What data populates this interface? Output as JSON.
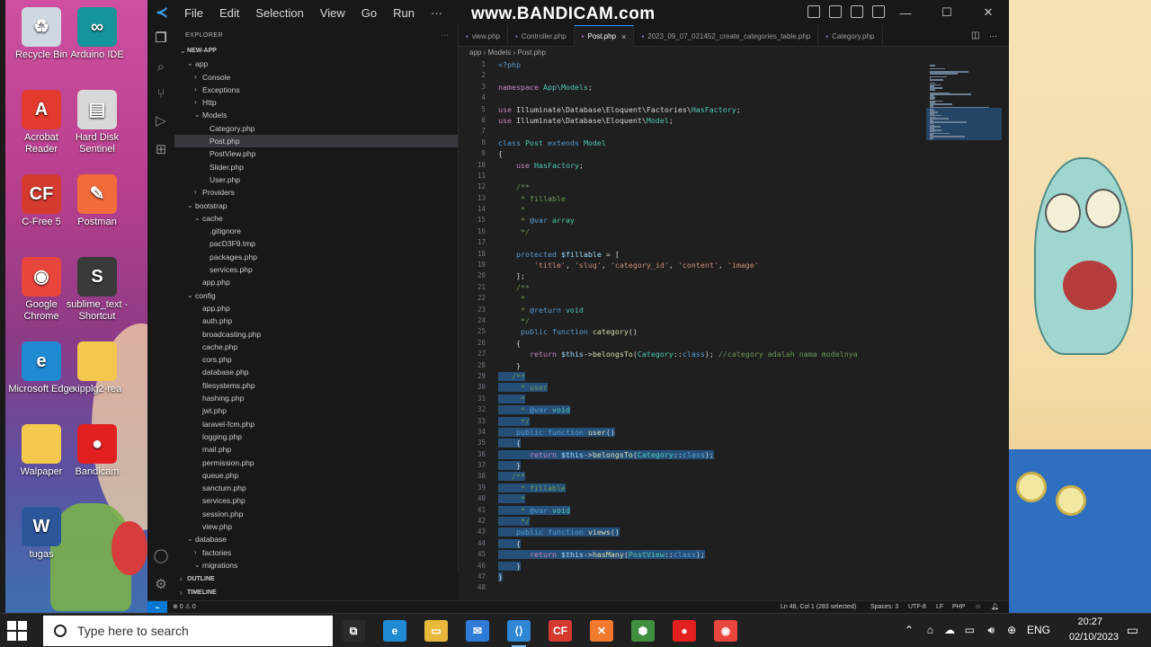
{
  "desktop": {
    "icons_left": [
      {
        "label": "Recycle Bin",
        "icon": "recycle-bin-icon",
        "color": "#cfd8e0",
        "glyph": "♻"
      },
      {
        "label": "Arduino IDE",
        "icon": "arduino-icon",
        "color": "#14959b",
        "glyph": "∞"
      },
      {
        "label": "Acrobat Reader",
        "icon": "acrobat-icon",
        "color": "#e23b2e",
        "glyph": "A"
      },
      {
        "label": "Hard Disk Sentinel",
        "icon": "hdd-sentinel-icon",
        "color": "#d8d8d8",
        "glyph": "▤"
      },
      {
        "label": "C-Free 5",
        "icon": "cfree-icon",
        "color": "#d63a2f",
        "glyph": "CF"
      },
      {
        "label": "Postman",
        "icon": "postman-icon",
        "color": "#f26b3a",
        "glyph": "✎"
      },
      {
        "label": "Google Chrome",
        "icon": "chrome-icon",
        "color": "#e8453c",
        "glyph": "◉"
      },
      {
        "label": "sublime_text - Shortcut",
        "icon": "sublime-icon",
        "color": "#3a3a3a",
        "glyph": "S"
      },
      {
        "label": "Microsoft Edge",
        "icon": "edge-icon",
        "color": "#1f8ad2",
        "glyph": "e"
      },
      {
        "label": "xipplg2-rea",
        "icon": "folder-icon",
        "color": "#f2c94c",
        "glyph": ""
      },
      {
        "label": "Walpaper",
        "icon": "folder-icon",
        "color": "#f2c94c",
        "glyph": ""
      },
      {
        "label": "Bandicam",
        "icon": "bandicam-icon",
        "color": "#e22020",
        "glyph": "●"
      },
      {
        "label": "tugas",
        "icon": "word-icon",
        "color": "#2b579a",
        "glyph": "W"
      }
    ]
  },
  "vscode": {
    "menu": [
      "File",
      "Edit",
      "Selection",
      "View",
      "Go",
      "Run",
      "···"
    ],
    "watermark": "www.BANDICAM.com",
    "explorer": {
      "header": "EXPLORER",
      "root": "NEW-APP",
      "tree": [
        {
          "name": "app",
          "depth": 1,
          "type": "folder-open"
        },
        {
          "name": "Console",
          "depth": 2,
          "type": "folder"
        },
        {
          "name": "Exceptions",
          "depth": 2,
          "type": "folder"
        },
        {
          "name": "Http",
          "depth": 2,
          "type": "folder"
        },
        {
          "name": "Models",
          "depth": 2,
          "type": "folder-open"
        },
        {
          "name": "Category.php",
          "depth": 3,
          "type": "file"
        },
        {
          "name": "Post.php",
          "depth": 3,
          "type": "file",
          "selected": true
        },
        {
          "name": "PostView.php",
          "depth": 3,
          "type": "file"
        },
        {
          "name": "Slider.php",
          "depth": 3,
          "type": "file"
        },
        {
          "name": "User.php",
          "depth": 3,
          "type": "file"
        },
        {
          "name": "Providers",
          "depth": 2,
          "type": "folder"
        },
        {
          "name": "bootstrap",
          "depth": 1,
          "type": "folder-open"
        },
        {
          "name": "cache",
          "depth": 2,
          "type": "folder-open"
        },
        {
          "name": ".gitignore",
          "depth": 3,
          "type": "file"
        },
        {
          "name": "pacD3F9.tmp",
          "depth": 3,
          "type": "file"
        },
        {
          "name": "packages.php",
          "depth": 3,
          "type": "file"
        },
        {
          "name": "services.php",
          "depth": 3,
          "type": "file"
        },
        {
          "name": "app.php",
          "depth": 2,
          "type": "file"
        },
        {
          "name": "config",
          "depth": 1,
          "type": "folder-open"
        },
        {
          "name": "app.php",
          "depth": 2,
          "type": "file"
        },
        {
          "name": "auth.php",
          "depth": 2,
          "type": "file"
        },
        {
          "name": "broadcasting.php",
          "depth": 2,
          "type": "file"
        },
        {
          "name": "cache.php",
          "depth": 2,
          "type": "file"
        },
        {
          "name": "cors.php",
          "depth": 2,
          "type": "file"
        },
        {
          "name": "database.php",
          "depth": 2,
          "type": "file"
        },
        {
          "name": "filesystems.php",
          "depth": 2,
          "type": "file"
        },
        {
          "name": "hashing.php",
          "depth": 2,
          "type": "file"
        },
        {
          "name": "jwt.php",
          "depth": 2,
          "type": "file"
        },
        {
          "name": "laravel-fcm.php",
          "depth": 2,
          "type": "file"
        },
        {
          "name": "logging.php",
          "depth": 2,
          "type": "file"
        },
        {
          "name": "mail.php",
          "depth": 2,
          "type": "file"
        },
        {
          "name": "permission.php",
          "depth": 2,
          "type": "file"
        },
        {
          "name": "queue.php",
          "depth": 2,
          "type": "file"
        },
        {
          "name": "sanctum.php",
          "depth": 2,
          "type": "file"
        },
        {
          "name": "services.php",
          "depth": 2,
          "type": "file"
        },
        {
          "name": "session.php",
          "depth": 2,
          "type": "file"
        },
        {
          "name": "view.php",
          "depth": 2,
          "type": "file"
        },
        {
          "name": "database",
          "depth": 1,
          "type": "folder-open"
        },
        {
          "name": "factories",
          "depth": 2,
          "type": "folder"
        },
        {
          "name": "migrations",
          "depth": 2,
          "type": "folder-open"
        }
      ],
      "outline": "OUTLINE",
      "timeline": "TIMELINE"
    },
    "tabs": [
      {
        "label": "view.php",
        "active": false
      },
      {
        "label": "Controller.php",
        "active": false
      },
      {
        "label": "Post.php",
        "active": true
      },
      {
        "label": "2023_09_07_021452_create_categories_table.php",
        "active": false
      },
      {
        "label": "Category.php",
        "active": false
      }
    ],
    "breadcrumb": "app › Models › Post.php",
    "code_lines": [
      {
        "n": 1,
        "html": "<span class=\"kw\">&lt;?php</span>"
      },
      {
        "n": 2,
        "html": ""
      },
      {
        "n": 3,
        "html": "<span class=\"kw2\">namespace</span> <span class=\"cls\">App\\Models</span>;"
      },
      {
        "n": 4,
        "html": ""
      },
      {
        "n": 5,
        "html": "<span class=\"kw2\">use</span> Illuminate\\Database\\Eloquent\\Factories\\<span class=\"cls\">HasFactory</span>;"
      },
      {
        "n": 6,
        "html": "<span class=\"kw2\">use</span> Illuminate\\Database\\Eloquent\\<span class=\"cls\">Model</span>;"
      },
      {
        "n": 7,
        "html": ""
      },
      {
        "n": 8,
        "html": "<span class=\"kw\">class</span> <span class=\"cls\">Post</span> <span class=\"kw\">extends</span> <span class=\"cls\">Model</span>"
      },
      {
        "n": 9,
        "html": "{"
      },
      {
        "n": 10,
        "html": "    <span class=\"kw2\">use</span> <span class=\"cls\">HasFactory</span>;"
      },
      {
        "n": 11,
        "html": ""
      },
      {
        "n": 12,
        "html": "    <span class=\"cm\">/**</span>"
      },
      {
        "n": 13,
        "html": "<span class=\"cm\">     * fillable</span>"
      },
      {
        "n": 14,
        "html": "<span class=\"cm\">     *</span>"
      },
      {
        "n": 15,
        "html": "<span class=\"cm\">     * </span><span class=\"kw\">@var</span> <span class=\"cls\">array</span>"
      },
      {
        "n": 16,
        "html": "<span class=\"cm\">     */</span>"
      },
      {
        "n": 17,
        "html": ""
      },
      {
        "n": 18,
        "html": "    <span class=\"kw\">protected</span> <span class=\"var\">$fillable</span> = ["
      },
      {
        "n": 19,
        "html": "        <span class=\"str\">'title'</span>, <span class=\"str\">'slug'</span>, <span class=\"str\">'category_id'</span>, <span class=\"str\">'content'</span>, <span class=\"str\">'image'</span>"
      },
      {
        "n": 20,
        "html": "    ];"
      },
      {
        "n": 21,
        "html": "    <span class=\"cm\">/**</span>"
      },
      {
        "n": 22,
        "html": "<span class=\"cm\">     *</span>"
      },
      {
        "n": 23,
        "html": "<span class=\"cm\">     * </span><span class=\"kw\">@return</span> <span class=\"cls\">void</span>"
      },
      {
        "n": 24,
        "html": "<span class=\"cm\">     */</span>"
      },
      {
        "n": 25,
        "html": "     <span class=\"kw\">public</span> <span class=\"kw\">function</span> <span class=\"fn\">category</span>()"
      },
      {
        "n": 26,
        "html": "    {"
      },
      {
        "n": 27,
        "html": "       <span class=\"kw2\">return</span> <span class=\"var\">$this</span>-&gt;<span class=\"fn\">belongsTo</span>(<span class=\"cls\">Category</span>::<span class=\"kw\">class</span>); <span class=\"cm\">//category adalah nama modelnya</span>"
      },
      {
        "n": 28,
        "html": "    }"
      },
      {
        "n": 29,
        "html": "<span class=\"hl\">   <span class=\"cm\">/**</span></span>"
      },
      {
        "n": 30,
        "html": "<span class=\"hl\"><span class=\"cm\">     * user</span></span>"
      },
      {
        "n": 31,
        "html": "<span class=\"hl\"><span class=\"cm\">     *</span></span>"
      },
      {
        "n": 32,
        "html": "<span class=\"hl\"><span class=\"cm\">     * </span><span class=\"kw\">@var</span> <span class=\"cls\">void</span></span>"
      },
      {
        "n": 33,
        "html": "<span class=\"hl\"><span class=\"cm\">     */</span></span>"
      },
      {
        "n": 34,
        "html": "<span class=\"hl\">    <span class=\"kw\">public</span> <span class=\"kw\">function</span> <span class=\"fn\">user</span>()</span>"
      },
      {
        "n": 35,
        "html": "<span class=\"hl\">    {</span>"
      },
      {
        "n": 36,
        "html": "<span class=\"hl\">       <span class=\"kw2\">return</span> <span class=\"var\">$this</span>-&gt;<span class=\"fn\">belongsTo</span>(<span class=\"cls\">Category</span>::<span class=\"kw\">class</span>);</span>"
      },
      {
        "n": 37,
        "html": "<span class=\"hl\">    }</span>"
      },
      {
        "n": 38,
        "html": "<span class=\"hl\">   <span class=\"cm\">/**</span></span>"
      },
      {
        "n": 39,
        "html": "<span class=\"hl\"><span class=\"cm\">     * fillable</span></span>"
      },
      {
        "n": 40,
        "html": "<span class=\"hl\"><span class=\"cm\">     *</span></span>"
      },
      {
        "n": 41,
        "html": "<span class=\"hl\"><span class=\"cm\">     * </span><span class=\"kw\">@var</span> <span class=\"cls\">void</span></span>"
      },
      {
        "n": 42,
        "html": "<span class=\"hl\"><span class=\"cm\">     */</span></span>"
      },
      {
        "n": 43,
        "html": "<span class=\"hl\">    <span class=\"kw\">public</span> <span class=\"kw\">function</span> <span class=\"fn\">views</span>()</span>"
      },
      {
        "n": 44,
        "html": "<span class=\"hl\">    {</span>"
      },
      {
        "n": 45,
        "html": "<span class=\"hl\">       <span class=\"kw2\">return</span> <span class=\"var\">$this</span>-&gt;<span class=\"fn\">hasMany</span>(<span class=\"cls\">PostView</span>::<span class=\"kw\">class</span>);</span>"
      },
      {
        "n": 46,
        "html": "<span class=\"hl\">    }</span>"
      },
      {
        "n": 47,
        "html": "<span class=\"hl\">}</span>"
      },
      {
        "n": 48,
        "html": ""
      }
    ],
    "statusbar": {
      "problems": "⊗ 0 ⚠ 0",
      "position": "Ln 48, Col 1 (283 selected)",
      "spaces": "Spaces: 3",
      "encoding": "UTF-8",
      "eol": "LF",
      "language": "PHP"
    }
  },
  "taskbar": {
    "search_placeholder": "Type here to search",
    "pinned": [
      {
        "name": "task-view",
        "color": "#2a2a2a",
        "glyph": "⧉"
      },
      {
        "name": "edge",
        "color": "#1f8ad2",
        "glyph": "e"
      },
      {
        "name": "file-explorer",
        "color": "#e8b83a",
        "glyph": "▭"
      },
      {
        "name": "mail",
        "color": "#2f7bd6",
        "glyph": "✉"
      },
      {
        "name": "vscode",
        "color": "#2f87d6",
        "glyph": "⟨⟩",
        "active": true
      },
      {
        "name": "cfree",
        "color": "#d63a2f",
        "glyph": "CF"
      },
      {
        "name": "xampp",
        "color": "#f27a2f",
        "glyph": "✕"
      },
      {
        "name": "node",
        "color": "#3f8f3f",
        "glyph": "⬢"
      },
      {
        "name": "bandicam",
        "color": "#e22020",
        "glyph": "●"
      },
      {
        "name": "chrome",
        "color": "#e8453c",
        "glyph": "◉"
      }
    ],
    "tray": {
      "language": "ENG",
      "time": "20:27",
      "date": "02/10/2023"
    }
  }
}
